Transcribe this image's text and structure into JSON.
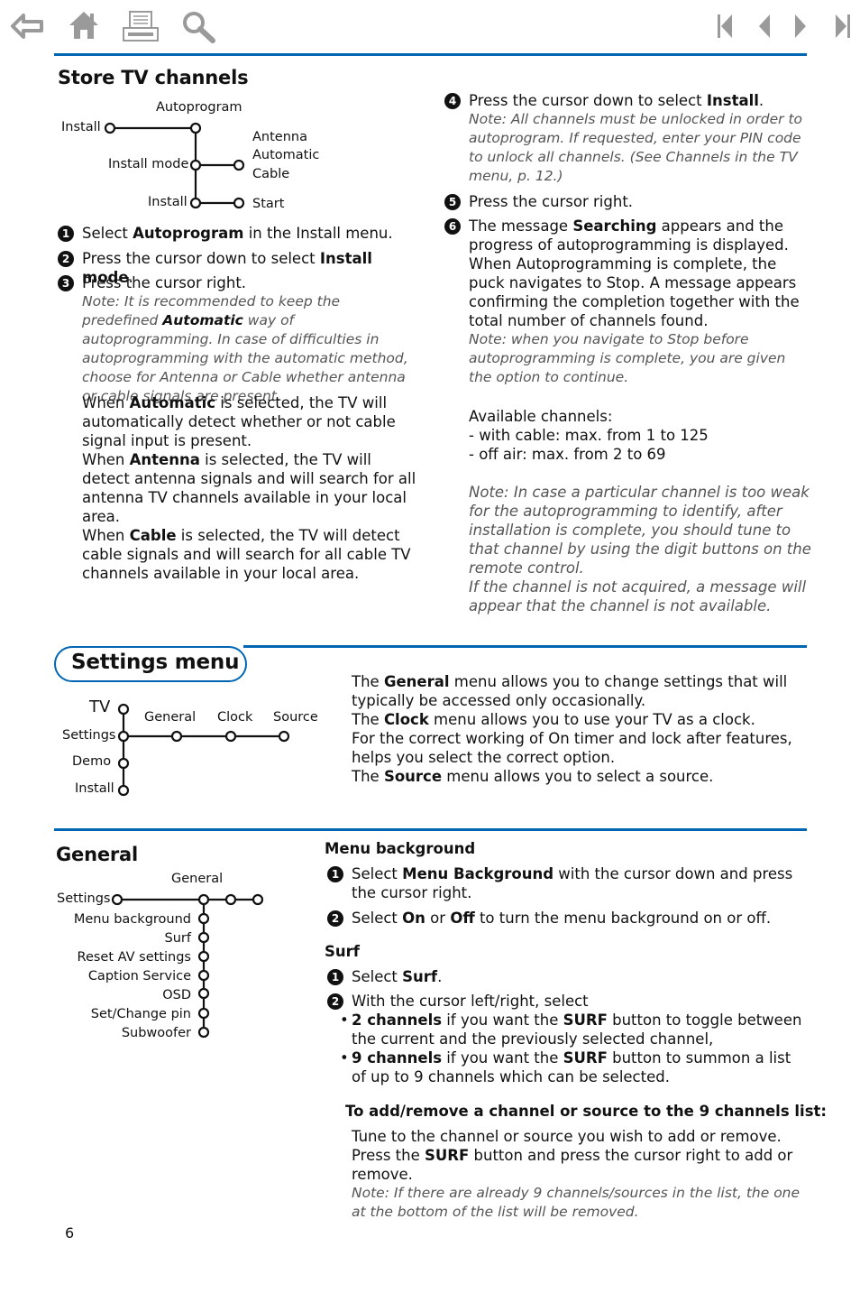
{
  "toolbar": {
    "left_icons": [
      "back-arrow-icon",
      "home-icon",
      "print-icon",
      "search-icon"
    ],
    "right_icons": [
      "first-page-icon",
      "previous-page-icon",
      "next-page-icon",
      "last-page-icon"
    ]
  },
  "colors": {
    "accent": "#0066b3",
    "icon_gray": "#9a9a9a",
    "note_gray": "#555555"
  },
  "store": {
    "title": "Store TV channels",
    "diagram": {
      "install_top": "Install",
      "autoprogram": "Autoprogram",
      "install_mode": "Install mode",
      "install_bottom": "Install",
      "options": [
        "Antenna",
        "Automatic",
        "Cable"
      ],
      "start": "Start"
    },
    "steps": [
      {
        "num": "1",
        "pre": "Select ",
        "bold": "Autoprogram",
        "post": " in the Install menu."
      },
      {
        "num": "2",
        "pre": "Press the cursor down to select ",
        "bold": "Install mode",
        "post": "."
      },
      {
        "num": "3",
        "text": "Press the cursor right.",
        "note_pre": "Note: It is recommended to keep the predefined ",
        "note_bold": "Automatic",
        "note_post": " way of autoprogramming.  In case of difficulties in autoprogramming with the automatic method, choose for Antenna or Cable whether antenna or cable signals are present."
      }
    ],
    "modes": [
      {
        "pre": "When ",
        "bold": "Automatic",
        "post": " is selected, the TV will automatically detect whether or not cable signal input is present."
      },
      {
        "pre": "When ",
        "bold": "Antenna",
        "post": " is selected, the TV will detect antenna signals and will search for all antenna TV channels available in your local area."
      },
      {
        "pre": "When ",
        "bold": "Cable",
        "post": " is selected, the TV will detect cable signals and will search for all cable TV channels available in your local area."
      }
    ],
    "step4": {
      "num": "4",
      "pre": "Press the cursor down to select ",
      "bold": "Install",
      "post": ".",
      "note": "Note: All channels must be unlocked in order to autoprogram. If requested, enter your PIN code to unlock all channels. (See Channels in the TV menu, p. 12.)"
    },
    "step5": {
      "num": "5",
      "text": "Press the cursor right."
    },
    "step6": {
      "num": "6",
      "pre": "The message ",
      "bold": "Searching",
      "post": " appears and the progress of autoprogramming is displayed. When Autoprogramming is complete, the puck navigates to Stop. A message appears confirming the completion together with the total number of channels found.",
      "note": "Note: when you navigate to Stop before autoprogramming is complete, you are given the option to continue."
    },
    "available": {
      "title": "Available channels:",
      "lines": [
        "- with cable: max. from 1 to 125",
        "- off air: max. from 2 to 69"
      ]
    },
    "weak_note": "Note: In case a particular channel is too weak for the autoprogramming to identify, after installation is complete, you should tune to that channel by using the digit buttons on the remote control.",
    "not_acquired_note": "If the channel is not acquired, a message will appear that the channel is not available."
  },
  "settings": {
    "title": "Settings menu",
    "diagram": {
      "vertical": [
        "TV",
        "Settings",
        "Demo",
        "Install"
      ],
      "horizontal": [
        "General",
        "Clock",
        "Source"
      ]
    },
    "paras": [
      {
        "pre": "The ",
        "bold": "General",
        "post": " menu allows you to change settings that will typically be accessed only occasionally."
      },
      {
        "pre": "The ",
        "bold": "Clock",
        "post": " menu allows you to use your TV as a clock."
      },
      {
        "text": "For the correct working of On timer and lock after features, helps you select the correct option."
      },
      {
        "pre": "The ",
        "bold": "Source",
        "post": " menu allows you to select a source."
      }
    ]
  },
  "general": {
    "title": "General",
    "diagram": {
      "root": "Settings",
      "header": "General",
      "items": [
        "Menu background",
        "Surf",
        "Reset AV settings",
        "Caption Service",
        "OSD",
        "Set/Change pin",
        "Subwoofer"
      ]
    },
    "menu_bg": {
      "title": "Menu background",
      "step1": {
        "num": "1",
        "pre": "Select ",
        "bold": "Menu Background",
        "post": " with the cursor down and press the cursor right."
      },
      "step2": {
        "num": "2",
        "pre": "Select ",
        "bold1": "On",
        "mid": " or ",
        "bold2": "Off",
        "post": " to turn the menu background on or off."
      }
    },
    "surf": {
      "title": "Surf",
      "step1": {
        "num": "1",
        "pre": "Select ",
        "bold": "Surf",
        "post": "."
      },
      "step2": {
        "num": "2",
        "text": "With the cursor left/right, select"
      },
      "bullets": [
        {
          "bold": "2 channels",
          "mid": " if you want the ",
          "bold2": "SURF",
          "post": " button to toggle between the current and the previously selected channel,"
        },
        {
          "bold": "9 channels",
          "mid": " if you want the ",
          "bold2": "SURF",
          "post": " button to summon a list of up to 9 channels which can be selected."
        }
      ]
    },
    "add_remove": {
      "title": "To add/remove a channel or source to the 9 channels list:",
      "line1": "Tune to the channel or source you wish to add or remove.",
      "pre": "Press the ",
      "bold": "SURF",
      "post": " button and press the cursor right to add or remove.",
      "note": "Note: If there are already 9 channels/sources in the list, the one at the bottom of the list will be removed."
    }
  },
  "page_number": "6"
}
